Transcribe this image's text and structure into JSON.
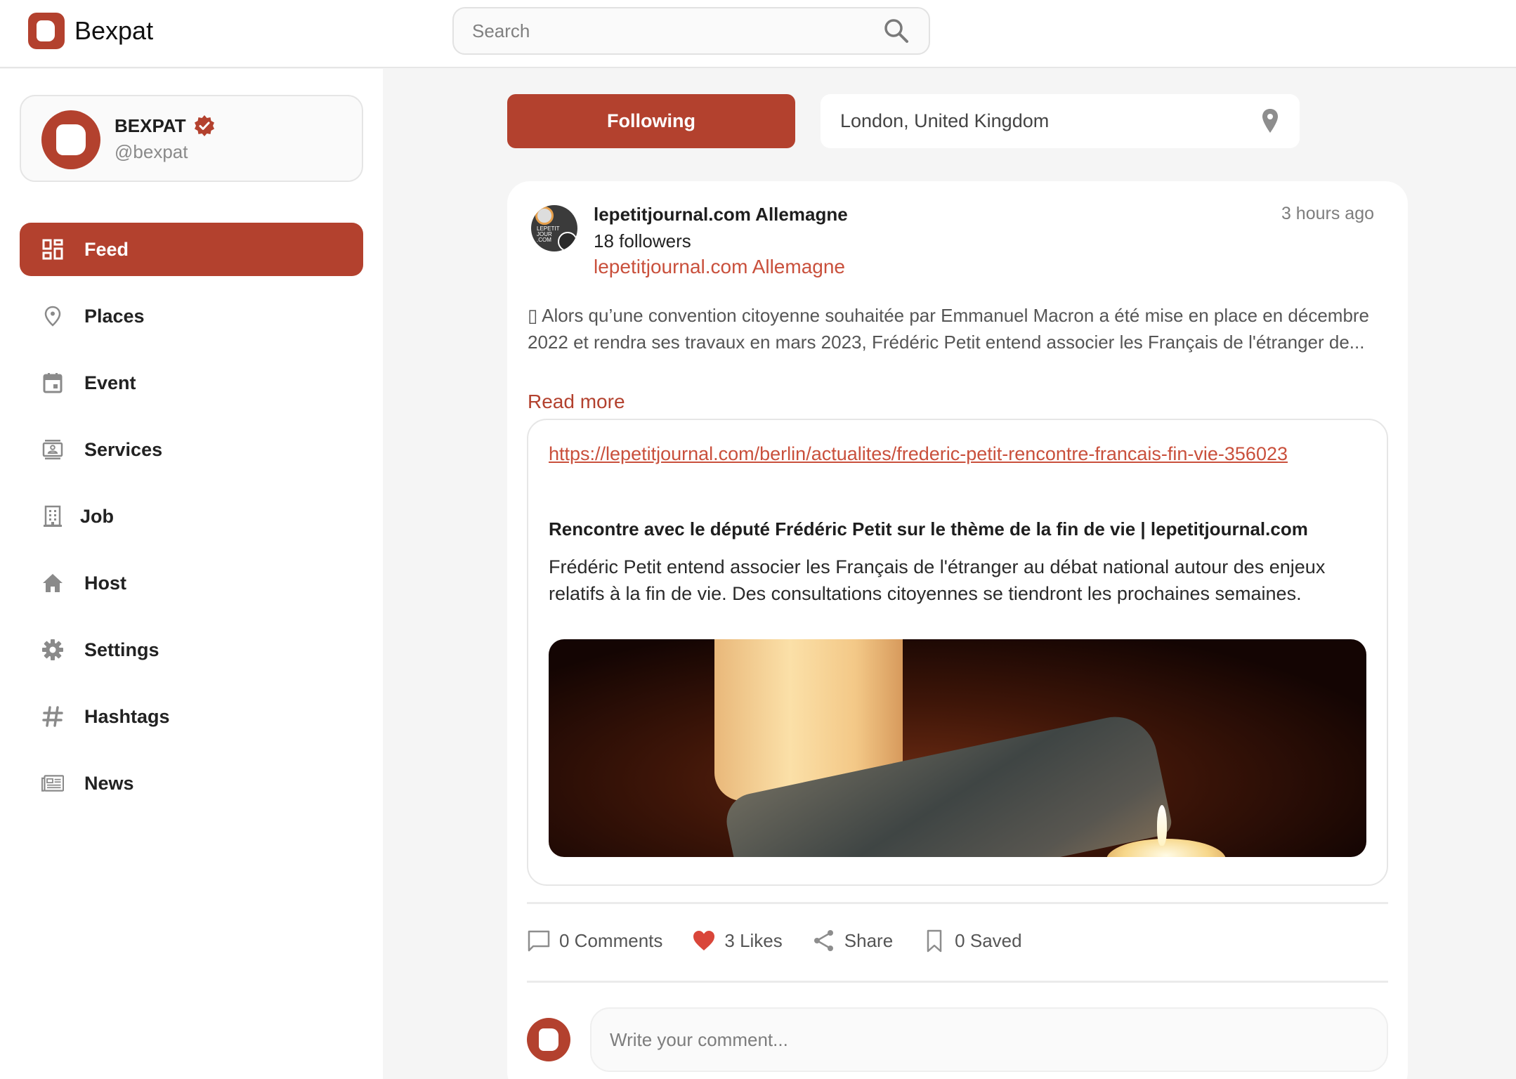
{
  "header": {
    "brand": "Bexpat",
    "search_placeholder": "Search",
    "search_value": ""
  },
  "profile": {
    "name": "BEXPAT",
    "handle": "@bexpat",
    "verified": true
  },
  "sidebar": {
    "items": [
      {
        "label": "Feed",
        "icon": "feed-icon",
        "active": true
      },
      {
        "label": "Places",
        "icon": "place-pin-icon",
        "active": false
      },
      {
        "label": "Event",
        "icon": "calendar-icon",
        "active": false
      },
      {
        "label": "Services",
        "icon": "contact-card-icon",
        "active": false
      },
      {
        "label": "Job",
        "icon": "building-icon",
        "active": false
      },
      {
        "label": "Host",
        "icon": "home-icon",
        "active": false
      },
      {
        "label": "Settings",
        "icon": "gear-icon",
        "active": false
      },
      {
        "label": "Hashtags",
        "icon": "hashtag-icon",
        "active": false
      },
      {
        "label": "News",
        "icon": "newspaper-icon",
        "active": false
      }
    ]
  },
  "filters": {
    "following_label": "Following",
    "location": "London, United Kingdom"
  },
  "post": {
    "author": "lepetitjournal.com Allemagne",
    "followers": "18 followers",
    "author_link": "lepetitjournal.com Allemagne",
    "timestamp": "3 hours ago",
    "text": "▯ Alors qu’une convention citoyenne souhaitée par Emmanuel Macron a été mise en place en décembre 2022 et rendra ses travaux en mars 2023, Frédéric Petit entend associer les Français de l'étranger de...",
    "read_more": "Read more",
    "link_preview": {
      "url": "https://lepetitjournal.com/berlin/actualites/frederic-petit-rencontre-francais-fin-vie-356023",
      "title": "Rencontre avec le député Frédéric Petit sur le thème de la fin de vie | lepetitjournal.com",
      "description": "Frédéric Petit entend associer les Français de l'étranger au débat national autour des enjeux relatifs à la fin de vie. Des consultations citoyennes se tiendront les prochaines semaines.",
      "image_alt": "Candles and a face mask on a wooden table"
    },
    "actions": {
      "comments": "0 Comments",
      "likes": "3 Likes",
      "share": "Share",
      "saved": "0 Saved"
    },
    "comment_placeholder": "Write your comment..."
  },
  "colors": {
    "accent": "#b3412e",
    "link": "#c9503c",
    "like": "#d9463a",
    "background": "#f5f5f5"
  }
}
